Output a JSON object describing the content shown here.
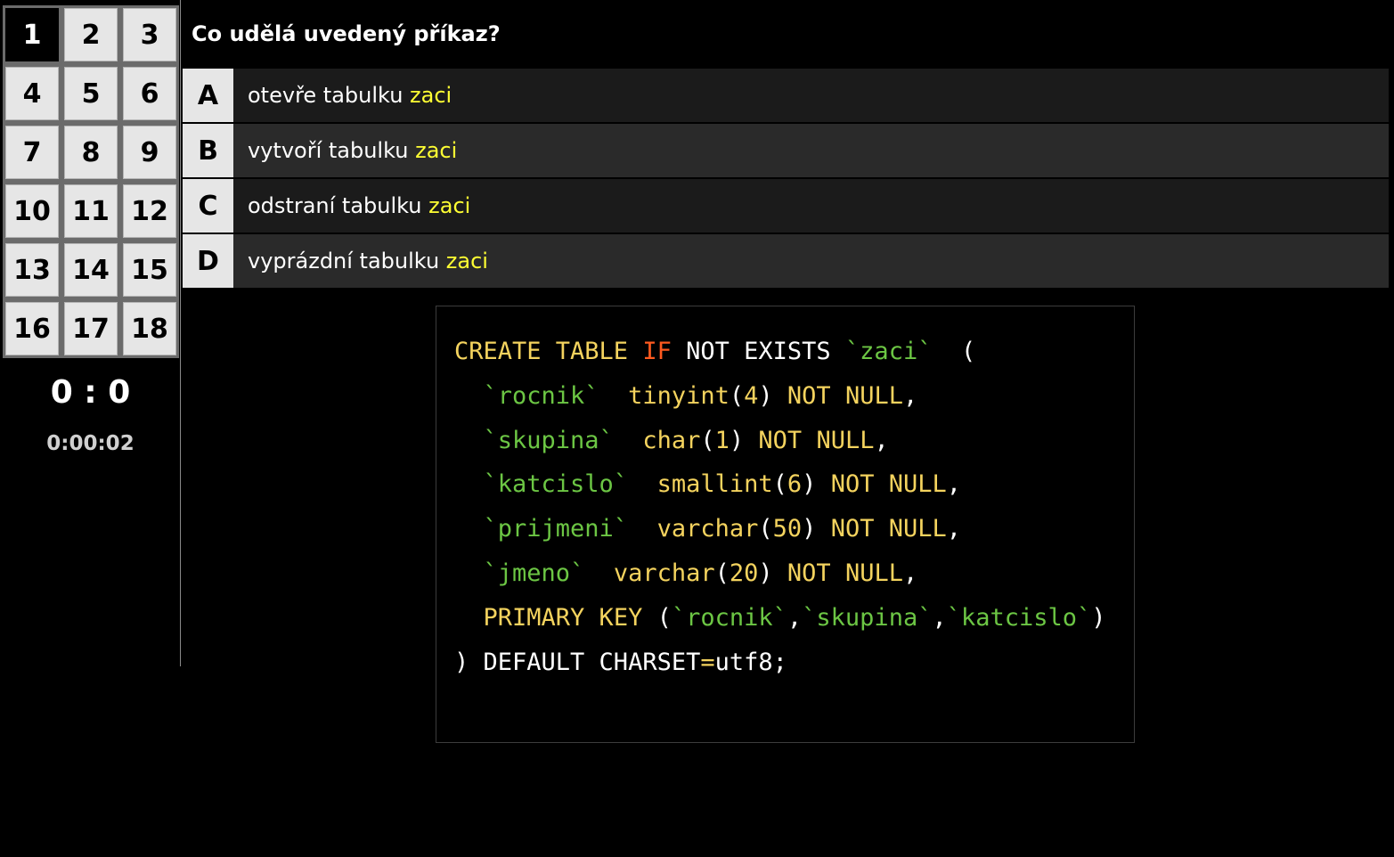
{
  "grid": {
    "cells": [
      {
        "label": "1",
        "active": true
      },
      {
        "label": "2"
      },
      {
        "label": "3"
      },
      {
        "label": "4"
      },
      {
        "label": "5"
      },
      {
        "label": "6"
      },
      {
        "label": "7"
      },
      {
        "label": "8"
      },
      {
        "label": "9"
      },
      {
        "label": "10"
      },
      {
        "label": "11"
      },
      {
        "label": "12"
      },
      {
        "label": "13"
      },
      {
        "label": "14"
      },
      {
        "label": "15"
      },
      {
        "label": "16"
      },
      {
        "label": "17"
      },
      {
        "label": "18"
      }
    ]
  },
  "score": "0 : 0",
  "timer": "0:00:02",
  "question": "Co udělá uvedený příkaz?",
  "answers": [
    {
      "letter": "A",
      "text": "otevře tabulku ",
      "highlight": "zaci"
    },
    {
      "letter": "B",
      "text": "vytvoří tabulku ",
      "highlight": "zaci"
    },
    {
      "letter": "C",
      "text": "odstraní tabulku ",
      "highlight": "zaci"
    },
    {
      "letter": "D",
      "text": "vyprázdní tabulku ",
      "highlight": "zaci"
    }
  ],
  "colors": {
    "background": "#000000",
    "highlight": "#ffff33",
    "keyword": "#f4d35e",
    "keyword_if": "#ff5a1f",
    "identifier": "#6cc644"
  },
  "code": {
    "lines": [
      [
        [
          "kw",
          "CREATE TABLE "
        ],
        [
          "kw-if",
          "IF"
        ],
        [
          "pl",
          " NOT EXISTS "
        ],
        [
          "id",
          "`zaci`"
        ],
        [
          "pl",
          "  ("
        ]
      ],
      [
        [
          "pl",
          "  "
        ],
        [
          "id",
          "`rocnik`"
        ],
        [
          "pl",
          "  "
        ],
        [
          "kw",
          "tinyint"
        ],
        [
          "pl",
          "("
        ],
        [
          "num",
          "4"
        ],
        [
          "pl",
          ") "
        ],
        [
          "kw",
          "NOT NULL"
        ],
        [
          "pl",
          ","
        ]
      ],
      [
        [
          "pl",
          "  "
        ],
        [
          "id",
          "`skupina`"
        ],
        [
          "pl",
          "  "
        ],
        [
          "kw",
          "char"
        ],
        [
          "pl",
          "("
        ],
        [
          "num",
          "1"
        ],
        [
          "pl",
          ") "
        ],
        [
          "kw",
          "NOT NULL"
        ],
        [
          "pl",
          ","
        ]
      ],
      [
        [
          "pl",
          "  "
        ],
        [
          "id",
          "`katcislo`"
        ],
        [
          "pl",
          "  "
        ],
        [
          "kw",
          "smallint"
        ],
        [
          "pl",
          "("
        ],
        [
          "num",
          "6"
        ],
        [
          "pl",
          ") "
        ],
        [
          "kw",
          "NOT NULL"
        ],
        [
          "pl",
          ","
        ]
      ],
      [
        [
          "pl",
          "  "
        ],
        [
          "id",
          "`prijmeni`"
        ],
        [
          "pl",
          "  "
        ],
        [
          "kw",
          "varchar"
        ],
        [
          "pl",
          "("
        ],
        [
          "num",
          "50"
        ],
        [
          "pl",
          ") "
        ],
        [
          "kw",
          "NOT NULL"
        ],
        [
          "pl",
          ","
        ]
      ],
      [
        [
          "pl",
          "  "
        ],
        [
          "id",
          "`jmeno`"
        ],
        [
          "pl",
          "  "
        ],
        [
          "kw",
          "varchar"
        ],
        [
          "pl",
          "("
        ],
        [
          "num",
          "20"
        ],
        [
          "pl",
          ") "
        ],
        [
          "kw",
          "NOT NULL"
        ],
        [
          "pl",
          ","
        ]
      ],
      [
        [
          "pl",
          "  "
        ],
        [
          "kw",
          "PRIMARY KEY"
        ],
        [
          "pl",
          " ("
        ],
        [
          "id",
          "`rocnik`"
        ],
        [
          "pl",
          ","
        ],
        [
          "id",
          "`skupina`"
        ],
        [
          "pl",
          ","
        ],
        [
          "id",
          "`katcislo`"
        ],
        [
          "pl",
          ")"
        ]
      ],
      [
        [
          "pl",
          ") DEFAULT CHARSET"
        ],
        [
          "op",
          "="
        ],
        [
          "pl",
          "utf8;"
        ]
      ]
    ]
  }
}
